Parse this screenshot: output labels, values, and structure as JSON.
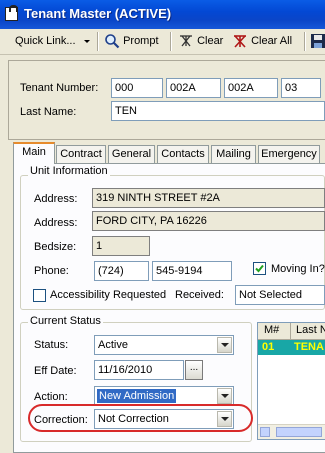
{
  "window": {
    "title": "Tenant Master (ACTIVE)"
  },
  "toolbar": {
    "quick_link": "Quick Link...",
    "prompt": "Prompt",
    "clear": "Clear",
    "clear_all": "Clear All"
  },
  "header": {
    "tenant_number_label": "Tenant Number:",
    "tenant_number": [
      "000",
      "002A",
      "002A",
      "03"
    ],
    "last_name_label": "Last Name:",
    "last_name": "TEN"
  },
  "tabs": [
    "Main",
    "Contract",
    "General",
    "Contacts",
    "Mailing",
    "Emergency"
  ],
  "unit_info": {
    "title": "Unit Information",
    "address_label": "Address:",
    "address1": "319   NINTH STREET #2A",
    "address2_label": "Address:",
    "address2": "FORD CITY, PA          16226",
    "bedsize_label": "Bedsize:",
    "bedsize": "1",
    "phone_label": "Phone:",
    "phone_area": "(724)",
    "phone_number": "545-9194",
    "moving_in_label": "Moving In?",
    "accessibility_label": "Accessibility Requested",
    "received_label": "Received:",
    "received_value": "Not Selected"
  },
  "current_status": {
    "title": "Current Status",
    "status_label": "Status:",
    "status_value": "Active",
    "eff_date_label": "Eff Date:",
    "eff_date": "11/16/2010",
    "ellipsis": "...",
    "action_label": "Action:",
    "action_value": "New Admission",
    "correction_label": "Correction:",
    "correction_value": "Not Correction"
  },
  "members_grid": {
    "headers": [
      "M#",
      "Last N"
    ],
    "rows": [
      [
        "01",
        "TENA"
      ]
    ]
  }
}
